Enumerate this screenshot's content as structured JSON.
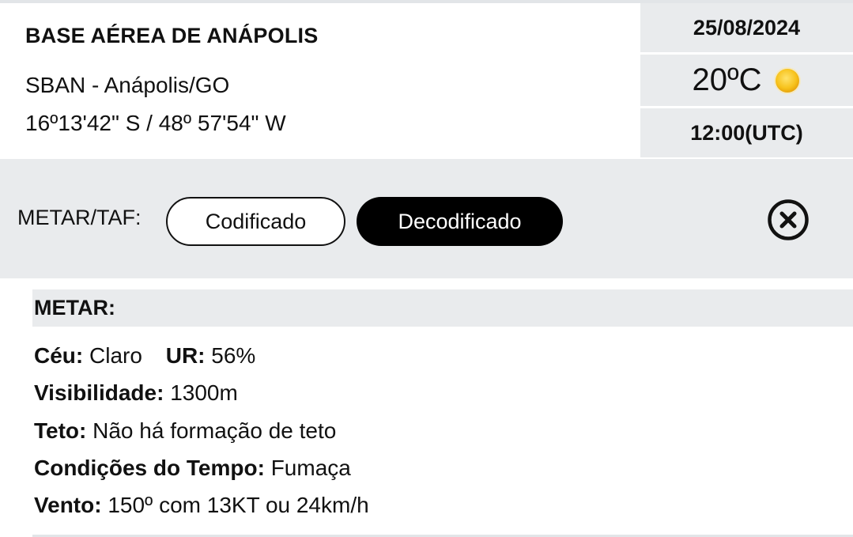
{
  "station": {
    "name": "BASE AÉREA DE ANÁPOLIS",
    "code_city": "SBAN - Anápolis/GO",
    "coordinates": "16º13'42\" S / 48º 57'54\" W"
  },
  "summary": {
    "date": "25/08/2024",
    "temperature": "20ºC",
    "weather_icon": "sun-icon",
    "time": "12:00(UTC)"
  },
  "toggle": {
    "label": "METAR/TAF:",
    "encoded_label": "Codificado",
    "decoded_label": "Decodificado",
    "selected": "Decodificado",
    "close_icon": "close-circle-icon"
  },
  "metar": {
    "title": "METAR:",
    "sky_label": "Céu:",
    "sky_value": "Claro",
    "humidity_label": "UR:",
    "humidity_value": "56%",
    "visibility_label": "Visibilidade:",
    "visibility_value": "1300m",
    "ceiling_label": "Teto:",
    "ceiling_value": "Não há formação de teto",
    "conditions_label": "Condições do Tempo:",
    "conditions_value": "Fumaça",
    "wind_label": "Vento:",
    "wind_value": "150º com 13KT ou 24km/h"
  },
  "colors": {
    "panel_gray": "#e9ebed",
    "active_pill": "#000000",
    "sun": "#f7c21b"
  }
}
